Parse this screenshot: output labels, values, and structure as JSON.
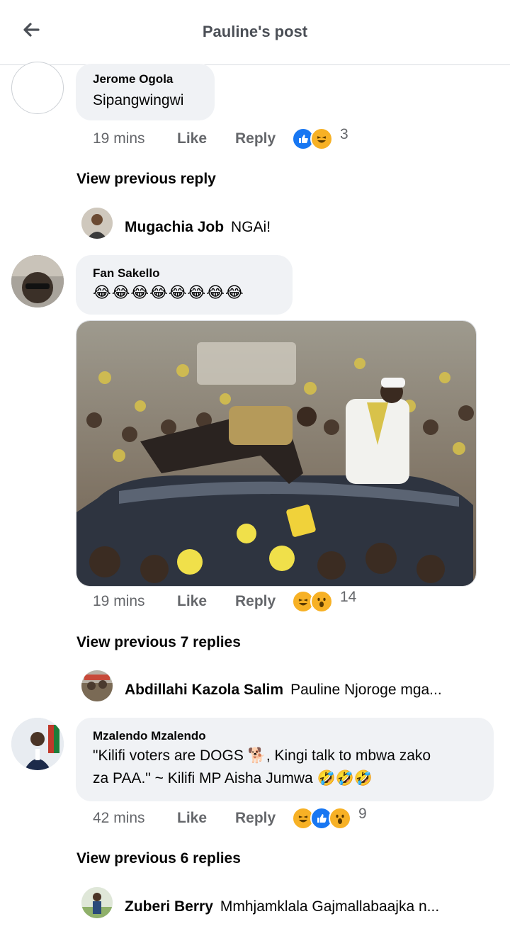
{
  "header": {
    "title": "Pauline's post",
    "back_icon": "arrow-left-icon"
  },
  "comments": [
    {
      "author": "Jerome Ogola",
      "text": "Sipangwingwi",
      "time": "19 mins",
      "like_label": "Like",
      "reply_label": "Reply",
      "reactions": [
        "like",
        "haha"
      ],
      "reaction_count": "3",
      "view_previous": "View previous reply",
      "reply_preview": {
        "author": "Mugachia Job",
        "text": "NGAi!"
      }
    },
    {
      "author": "Fan Sakello",
      "text": "😂😂😂😂😂😂😂😂",
      "has_photo": true,
      "time": "19 mins",
      "like_label": "Like",
      "reply_label": "Reply",
      "reactions": [
        "haha",
        "wow"
      ],
      "reaction_count": "14",
      "view_previous": "View previous 7 replies",
      "reply_preview": {
        "author": "Abdillahi Kazola Salim",
        "text": "Pauline Njoroge mga..."
      }
    },
    {
      "author": "Mzalendo Mzalendo",
      "text_line1": "\"Kilifi voters are DOGS 🐕, Kingi talk to mbwa zako",
      "text_line2": "za PAA.\" ~ Kilifi MP Aisha Jumwa 🤣🤣🤣",
      "time": "42 mins",
      "like_label": "Like",
      "reply_label": "Reply",
      "reactions": [
        "haha",
        "like",
        "wow"
      ],
      "reaction_count": "9",
      "view_previous": "View previous 6 replies",
      "reply_preview": {
        "author": "Zuberi Berry",
        "text": "Mmhjamklala Gajmallabaajka n..."
      }
    }
  ],
  "colors": {
    "like_blue": "#1877f2",
    "emoji_yellow": "#f7b125",
    "bubble_bg": "#f0f2f5",
    "meta_gray": "#65676b"
  }
}
